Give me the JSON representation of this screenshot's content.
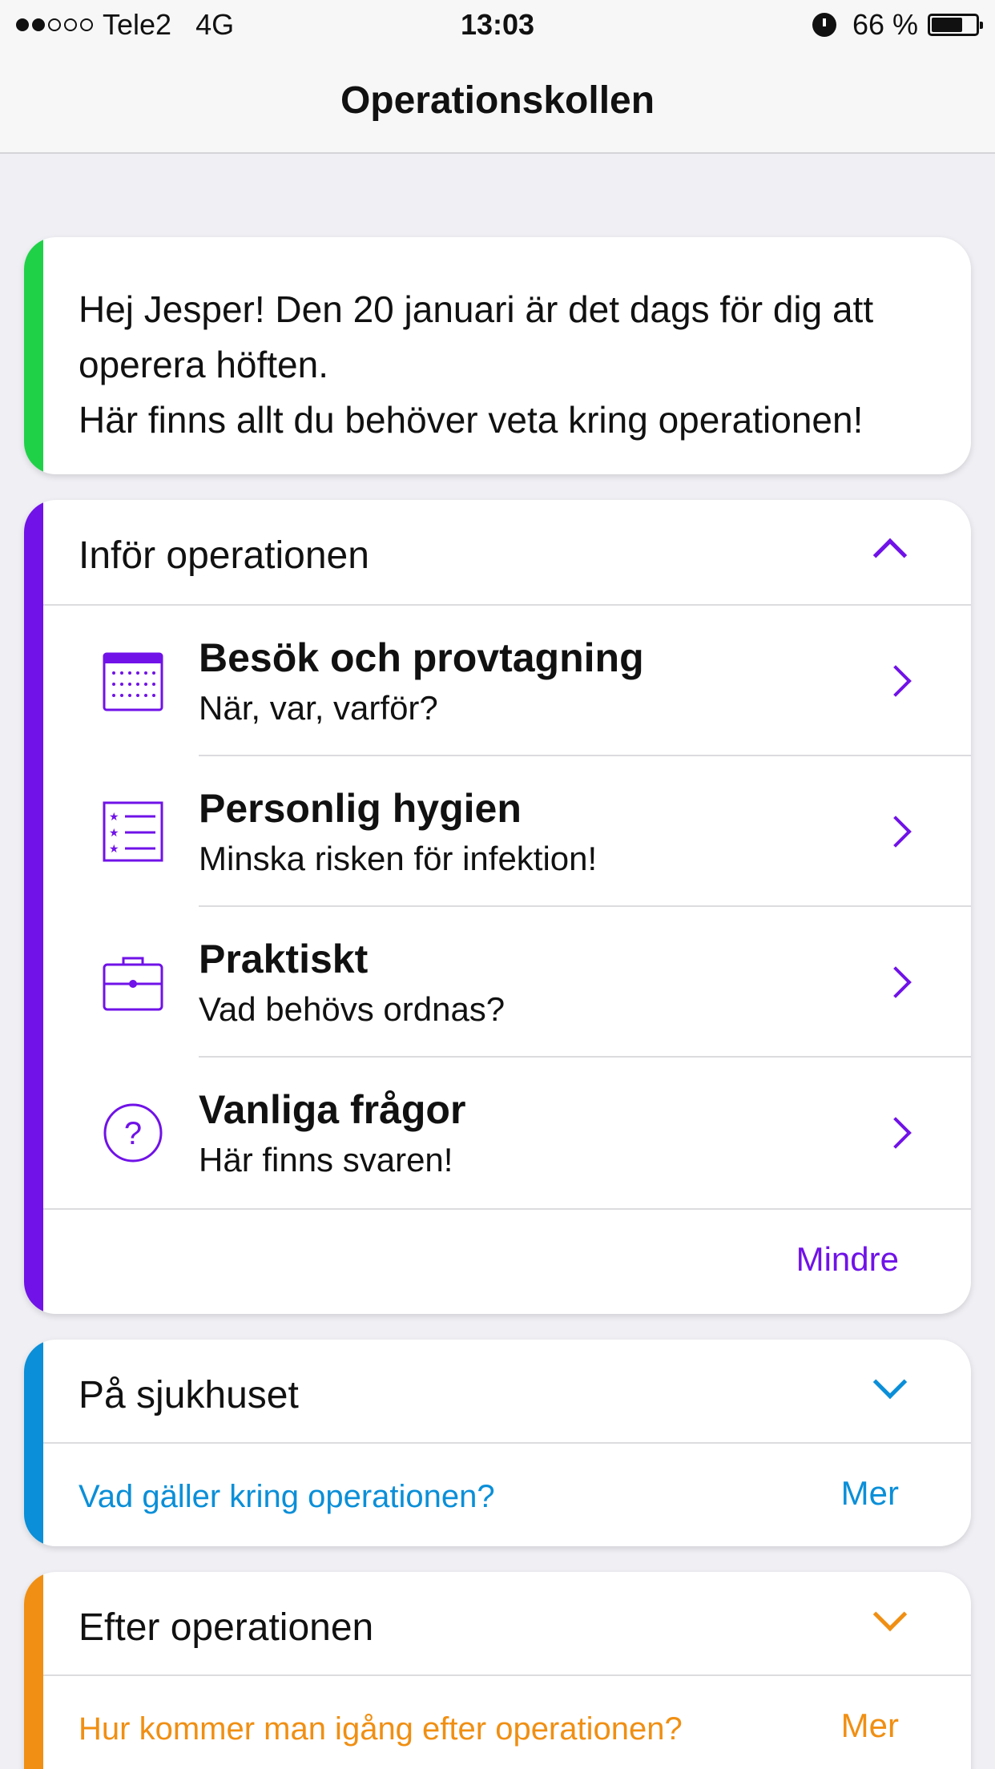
{
  "status_bar": {
    "carrier": "Tele2",
    "network": "4G",
    "time": "13:03",
    "battery": "66 %",
    "battery_level": 0.66,
    "signal_bars_filled": 2,
    "signal_bars_total": 5
  },
  "nav": {
    "title": "Operationskollen"
  },
  "intro": {
    "line1": "Hej Jesper! Den 20 januari är det dags för dig att operera höften.",
    "line2": "Här finns allt du behöver veta kring operationen!",
    "accent": "#1fd147"
  },
  "prep": {
    "title": "Inför operationen",
    "accent": "#7012e8",
    "items": [
      {
        "title": "Besök och provtagning",
        "subtitle": "När, var, varför?",
        "icon": "calendar-icon"
      },
      {
        "title": "Personlig hygien",
        "subtitle": "Minska risken för infektion!",
        "icon": "checklist-icon"
      },
      {
        "title": "Praktiskt",
        "subtitle": "Vad behövs ordnas?",
        "icon": "briefcase-icon"
      },
      {
        "title": "Vanliga frågor",
        "subtitle": "Här finns svaren!",
        "icon": "question-icon"
      }
    ],
    "less_label": "Mindre"
  },
  "hospital": {
    "title": "På sjukhuset",
    "teaser": "Vad gäller kring operationen?",
    "more_label": "Mer",
    "accent": "#0a8fd8"
  },
  "after": {
    "title": "Efter operationen",
    "teaser": "Hur kommer man igång efter operationen?",
    "more_label": "Mer",
    "accent": "#f08f13"
  }
}
